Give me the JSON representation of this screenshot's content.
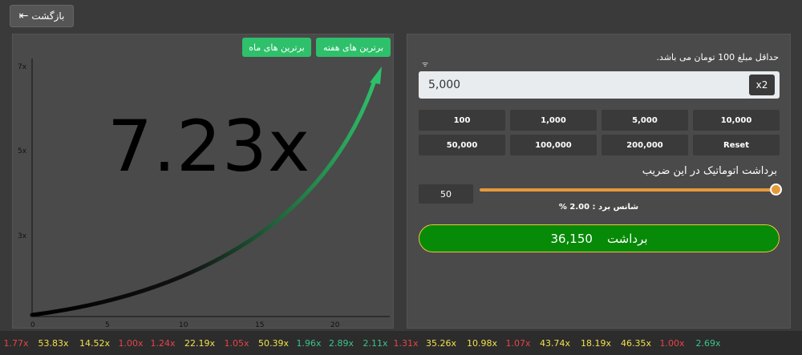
{
  "header": {
    "back_label": "بازگشت"
  },
  "graph": {
    "multiplier": "7.23x",
    "leaderboard_week": "برترین های هفته",
    "leaderboard_month": "برترین های ماه",
    "y_ticks": [
      "7x",
      "5x",
      "3x"
    ],
    "x_ticks": [
      "0",
      "5",
      "10",
      "15",
      "20"
    ]
  },
  "bet": {
    "min_note": "حداقل مبلغ 100 تومان می باشد.",
    "amount_value": "5,000",
    "double_label": "x2",
    "presets": [
      "100",
      "1,000",
      "5,000",
      "10,000",
      "50,000",
      "100,000",
      "200,000",
      "Reset"
    ],
    "auto_label": "برداشت اتوماتیک در این ضریب",
    "auto_value": "50",
    "win_chance": "شانس برد : 2.00 %",
    "cashout_label": "برداشت",
    "cashout_amount": "36,150"
  },
  "history": [
    {
      "value": "1.77x",
      "color": "#e8434a"
    },
    {
      "value": "53.83x",
      "color": "#f2e04a"
    },
    {
      "value": "14.52x",
      "color": "#f2e04a"
    },
    {
      "value": "1.00x",
      "color": "#e8434a"
    },
    {
      "value": "1.24x",
      "color": "#e8434a"
    },
    {
      "value": "22.19x",
      "color": "#f2e04a"
    },
    {
      "value": "1.05x",
      "color": "#e8434a"
    },
    {
      "value": "50.39x",
      "color": "#f2e04a"
    },
    {
      "value": "1.96x",
      "color": "#3bc48a"
    },
    {
      "value": "2.89x",
      "color": "#3bc48a"
    },
    {
      "value": "2.11x",
      "color": "#3bc48a"
    },
    {
      "value": "1.31x",
      "color": "#e8434a"
    },
    {
      "value": "35.26x",
      "color": "#f2e04a"
    },
    {
      "value": "10.98x",
      "color": "#f2e04a"
    },
    {
      "value": "1.07x",
      "color": "#e8434a"
    },
    {
      "value": "43.74x",
      "color": "#f2e04a"
    },
    {
      "value": "18.19x",
      "color": "#f2e04a"
    },
    {
      "value": "46.35x",
      "color": "#f2e04a"
    },
    {
      "value": "1.00x",
      "color": "#e8434a"
    },
    {
      "value": "2.69x",
      "color": "#3bc48a"
    }
  ],
  "colors": {
    "green": "#2ec06a",
    "cashout_bg": "#078a07",
    "slider": "#e39a3b"
  }
}
